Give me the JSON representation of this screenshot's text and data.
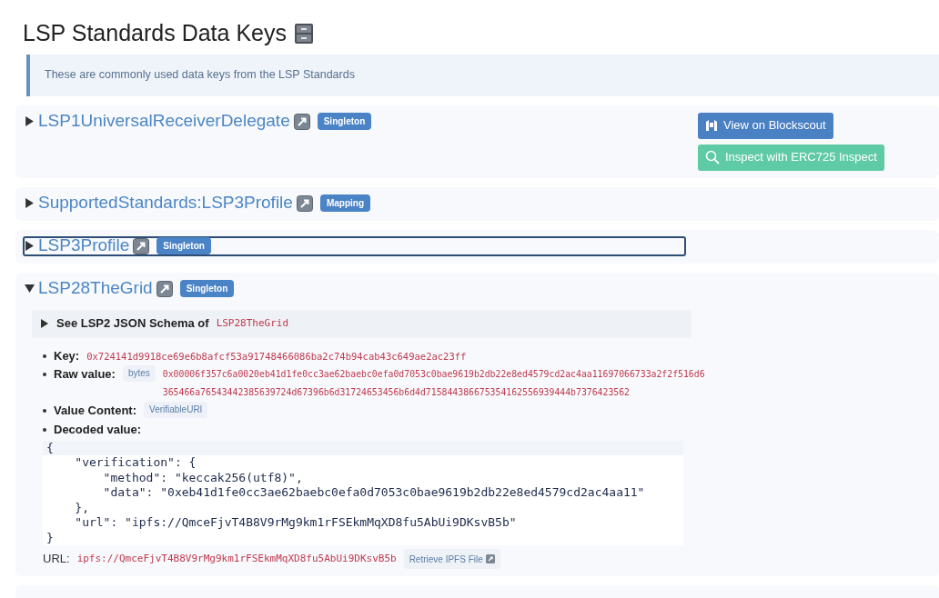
{
  "title": "LSP Standards Data Keys",
  "note": "These are commonly used data keys from the LSP Standards",
  "keys": [
    {
      "name": "LSP1UniversalReceiverDelegate",
      "badge": "Singleton",
      "expanded": false,
      "focused": false,
      "buttons": [
        {
          "kind": "blockscout",
          "label": "View on Blockscout"
        },
        {
          "kind": "inspect",
          "label": "Inspect with ERC725 Inspect"
        }
      ]
    },
    {
      "name": "SupportedStandards:LSP3Profile",
      "badge": "Mapping",
      "expanded": false,
      "focused": false
    },
    {
      "name": "LSP3Profile",
      "badge": "Singleton",
      "expanded": false,
      "focused": true
    },
    {
      "name": "LSP28TheGrid",
      "badge": "Singleton",
      "expanded": true,
      "focused": false,
      "schema": {
        "label": "See LSP2 JSON Schema of",
        "code": "LSP28TheGrid",
        "expanded": false
      },
      "fields": [
        {
          "kind": "code",
          "label": "Key:",
          "value": "0x724141d9918ce69e6b8afcf53a91748466086ba2c74b94cab43c649ae2ac23ff"
        },
        {
          "kind": "typed",
          "label": "Raw value:",
          "tag": "bytes",
          "value": "0x00006f357c6a0020eb41d1fe0cc3ae62baebc0efa0d7053c0bae9619b2db22e8ed4579cd2ac4aa11697066733a2f2f516d6365466a76543442385639724d67396b6d31724653456b6d4d715844386675354162556939444b7376423562"
        },
        {
          "kind": "tag",
          "label": "Value Content:",
          "tag": "VerifiableURI"
        },
        {
          "kind": "label",
          "label": "Decoded value:"
        }
      ],
      "decoded": [
        "{",
        "    \"verification\": {",
        "        \"method\": \"keccak256(utf8)\",",
        "        \"data\": \"0xeb41d1fe0cc3ae62baebc0efa0d7053c0bae9619b2db22e8ed4579cd2ac4aa11\"",
        "    },",
        "    \"url\": \"ipfs://QmceFjvT4B8V9rMg9km1rFSEkmMqXD8fu5AbUi9DKsvB5b\"",
        "}"
      ],
      "url": {
        "label": "URL:",
        "value": "ipfs://QmceFjvT4B8V9rMg9km1rFSEkmMqXD8fu5AbUi9DKsvB5b",
        "button": "Retrieve IPFS File"
      }
    }
  ]
}
